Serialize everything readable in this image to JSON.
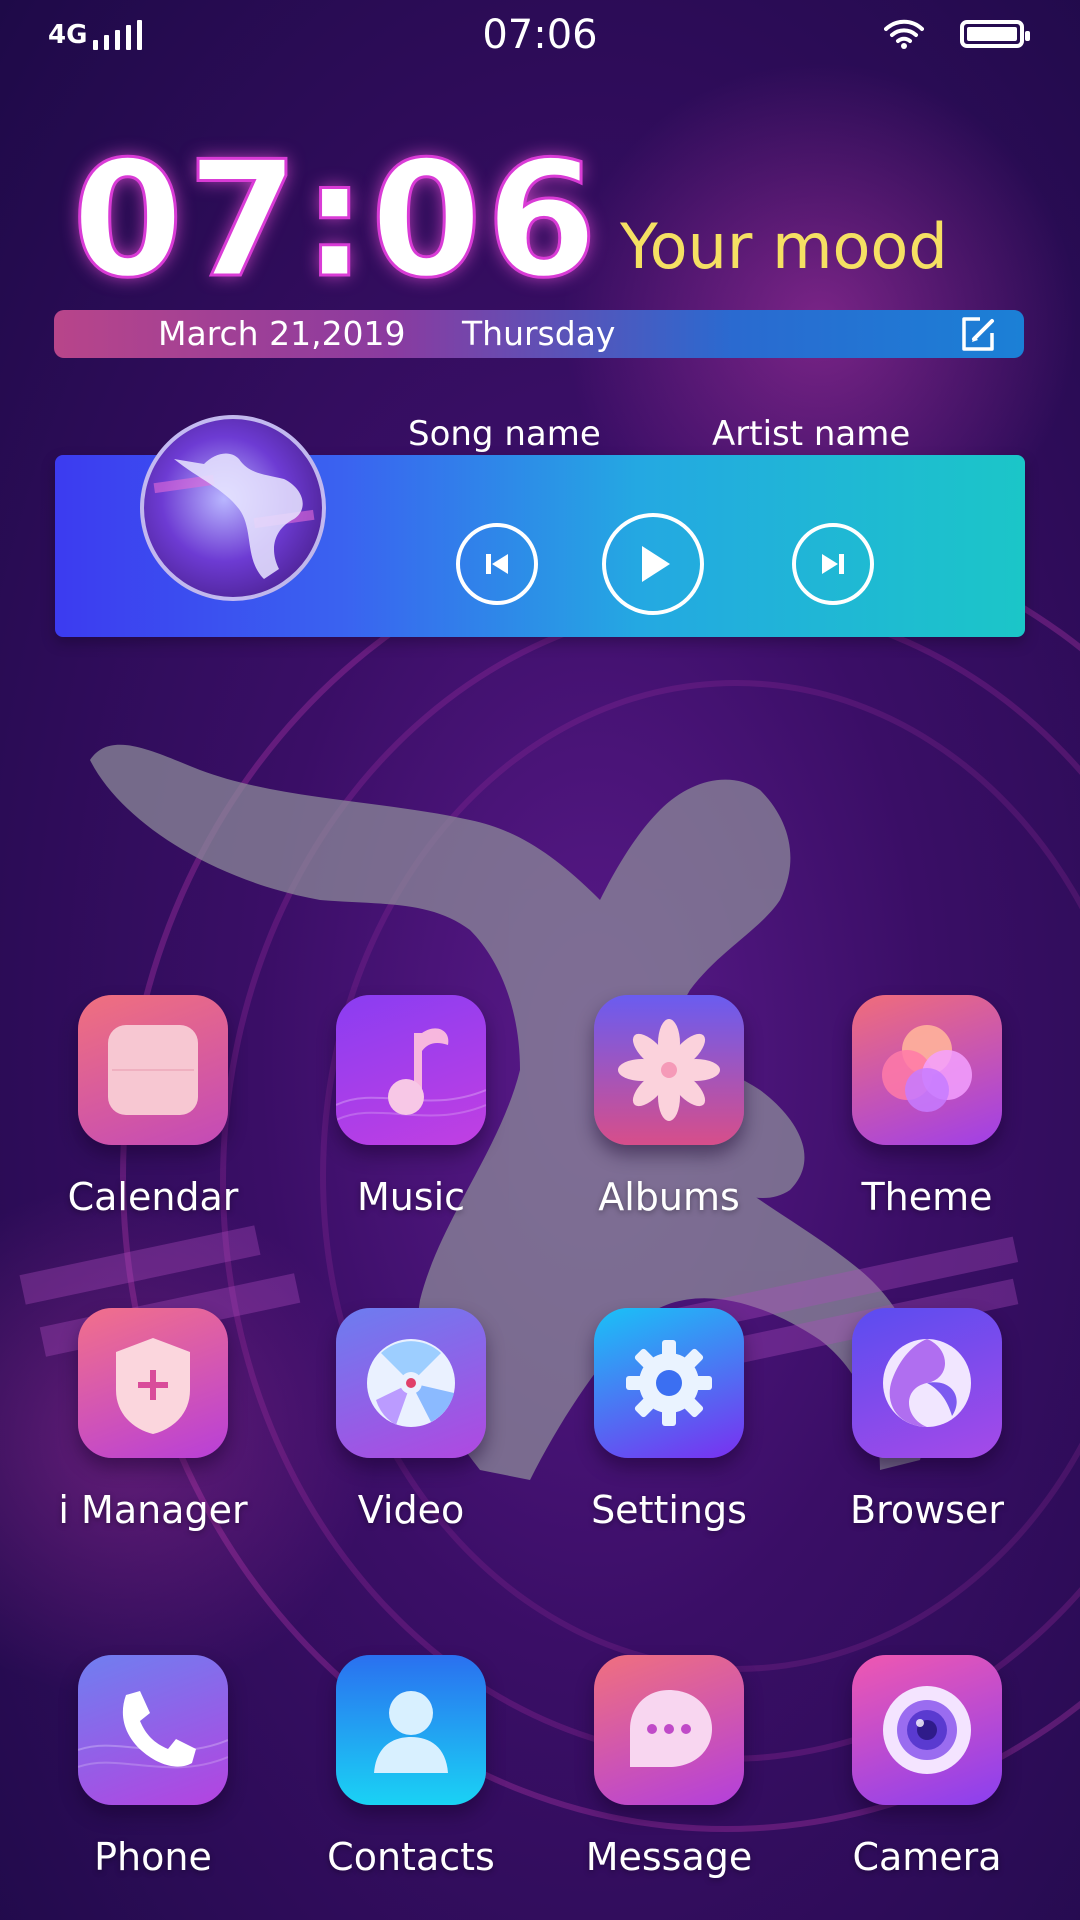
{
  "status_bar": {
    "network": "4G",
    "time": "07:06",
    "wifi_icon": "wifi-icon",
    "battery_icon": "battery-icon"
  },
  "widget": {
    "clock": "07:06",
    "mood": "Your mood",
    "date": "March 21,2019",
    "weekday": "Thursday",
    "edit_icon": "edit-icon"
  },
  "music_player": {
    "song_name": "Song name",
    "artist_name": "Artist name",
    "controls": [
      "previous-icon",
      "play-icon",
      "next-icon"
    ]
  },
  "apps": [
    {
      "label": "Calendar",
      "icon": "calendar-icon"
    },
    {
      "label": "Music",
      "icon": "music-note-icon"
    },
    {
      "label": "Albums",
      "icon": "flower-icon"
    },
    {
      "label": "Theme",
      "icon": "petals-icon"
    },
    {
      "label": "i Manager",
      "icon": "shield-plus-icon"
    },
    {
      "label": "Video",
      "icon": "disc-icon"
    },
    {
      "label": "Settings",
      "icon": "gear-icon"
    },
    {
      "label": "Browser",
      "icon": "swirl-icon"
    },
    {
      "label": "Phone",
      "icon": "phone-icon"
    },
    {
      "label": "Contacts",
      "icon": "person-icon"
    },
    {
      "label": "Message",
      "icon": "chat-bubble-icon"
    },
    {
      "label": "Camera",
      "icon": "camera-lens-icon"
    }
  ],
  "colors": {
    "mood_text": "#f5e063",
    "clock_stroke": "#d93bd6",
    "player_start": "#3c3bf0",
    "player_end": "#1bc6c8"
  }
}
